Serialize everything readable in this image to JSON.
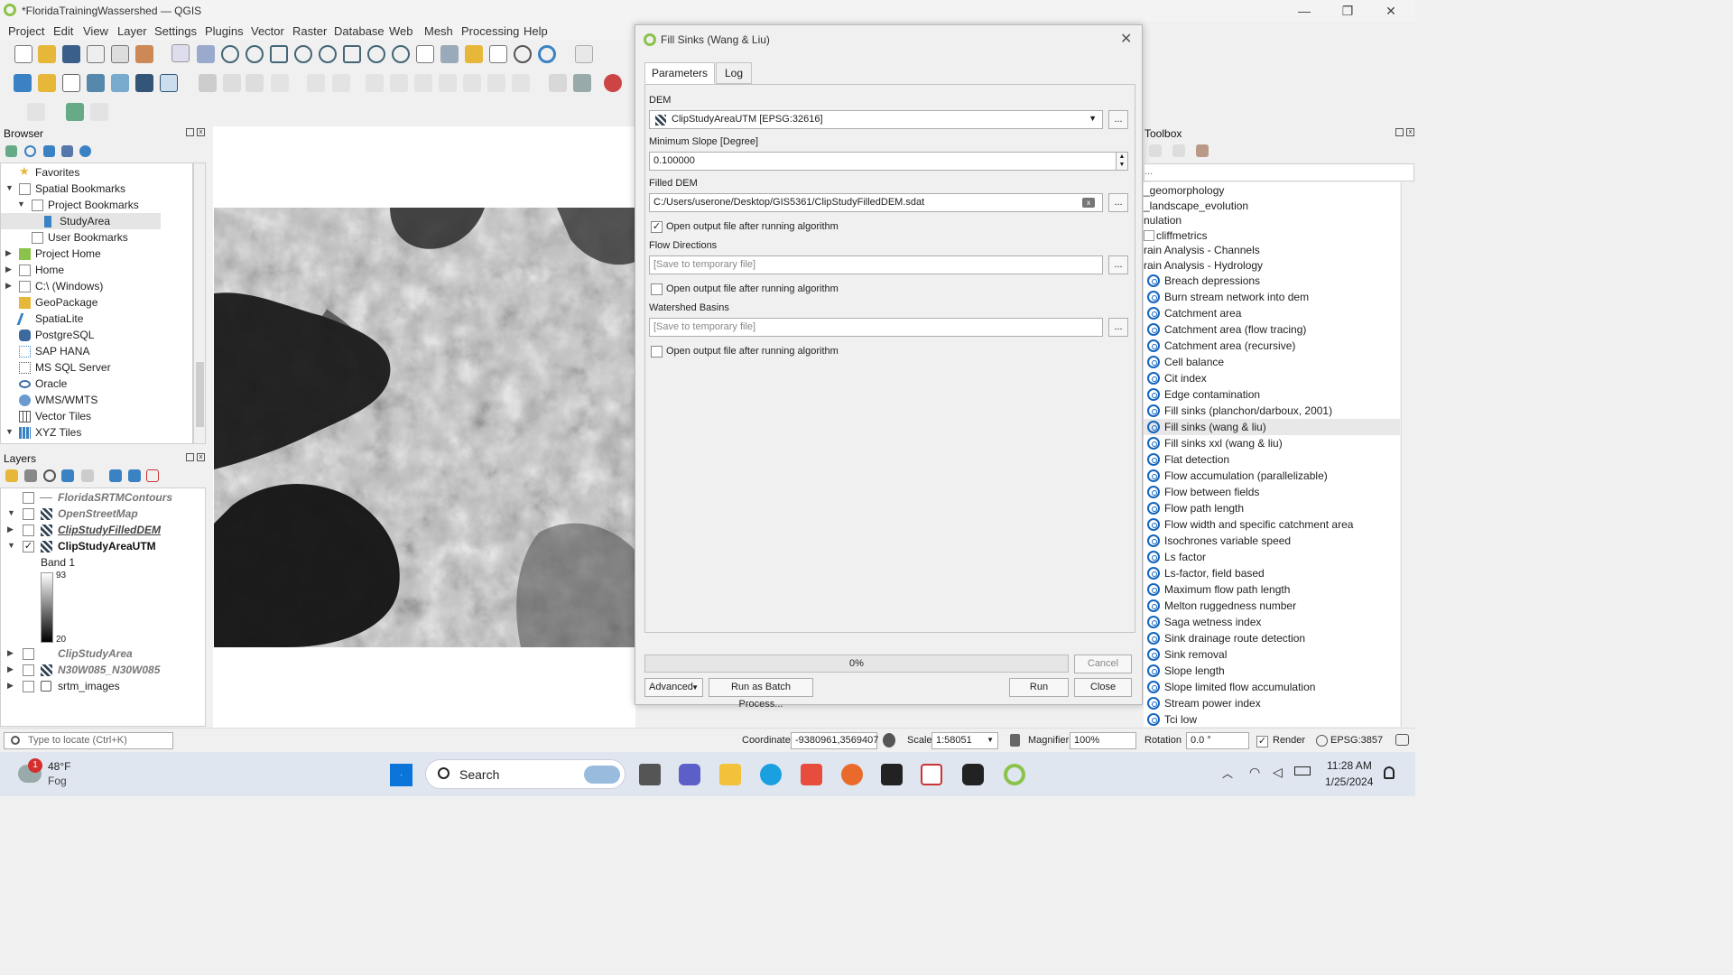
{
  "window": {
    "title": "*FloridaTrainingWassershed — QGIS"
  },
  "menu": [
    "Project",
    "Edit",
    "View",
    "Layer",
    "Settings",
    "Plugins",
    "Vector",
    "Raster",
    "Database",
    "Web",
    "Mesh",
    "Processing",
    "Help"
  ],
  "browser": {
    "title": "Browser",
    "items": [
      {
        "label": "Favorites"
      },
      {
        "label": "Spatial Bookmarks"
      },
      {
        "label": "Project Bookmarks"
      },
      {
        "label": "StudyArea"
      },
      {
        "label": "User Bookmarks"
      },
      {
        "label": "Project Home"
      },
      {
        "label": "Home"
      },
      {
        "label": "C:\\ (Windows)"
      },
      {
        "label": "GeoPackage"
      },
      {
        "label": "SpatiaLite"
      },
      {
        "label": "PostgreSQL"
      },
      {
        "label": "SAP HANA"
      },
      {
        "label": "MS SQL Server"
      },
      {
        "label": "Oracle"
      },
      {
        "label": "WMS/WMTS"
      },
      {
        "label": "Vector Tiles"
      },
      {
        "label": "XYZ Tiles"
      }
    ]
  },
  "layers": {
    "title": "Layers",
    "items": [
      {
        "label": "FloridaSRTMContours",
        "checked": false
      },
      {
        "label": "OpenStreetMap",
        "checked": false
      },
      {
        "label": "ClipStudyFilledDEM",
        "checked": false
      },
      {
        "label": "ClipStudyAreaUTM",
        "checked": true
      },
      {
        "label": "ClipStudyArea",
        "checked": false
      },
      {
        "label": "N30W085_N30W085",
        "checked": false
      },
      {
        "label": "srtm_images",
        "checked": false
      }
    ],
    "band_label": "Band 1",
    "legend_max": "93",
    "legend_min": "20"
  },
  "dialog": {
    "title": "Fill Sinks (Wang & Liu)",
    "tabs": [
      "Parameters",
      "Log"
    ],
    "dem_label": "DEM",
    "dem_value": "ClipStudyAreaUTM [EPSG:32616]",
    "min_slope_label": "Minimum Slope [Degree]",
    "min_slope_value": "0.100000",
    "filled_dem_label": "Filled DEM",
    "filled_dem_value": "C:/Users/userone/Desktop/GIS5361/ClipStudyFilledDEM.sdat",
    "open_output_label": "Open output file after running algorithm",
    "flow_dir_label": "Flow Directions",
    "watershed_label": "Watershed Basins",
    "placeholder": "[Save to temporary file]",
    "dots": "...",
    "progress": "0%",
    "progress_value": 0,
    "cancel": "Cancel",
    "advanced": "Advanced",
    "batch": "Run as Batch Process...",
    "run": "Run",
    "close": "Close"
  },
  "toolbox": {
    "title": "Toolbox",
    "groups": [
      "_geomorphology",
      "_landscape_evolution",
      "nulation",
      "cliffmetrics",
      "rain Analysis - Channels",
      "rain Analysis - Hydrology"
    ],
    "items": [
      "Breach depressions",
      "Burn stream network into dem",
      "Catchment area",
      "Catchment area (flow tracing)",
      "Catchment area (recursive)",
      "Cell balance",
      "Cit index",
      "Edge contamination",
      "Fill sinks (planchon/darboux, 2001)",
      "Fill sinks (wang & liu)",
      "Fill sinks xxl (wang & liu)",
      "Flat detection",
      "Flow accumulation (parallelizable)",
      "Flow between fields",
      "Flow path length",
      "Flow width and specific catchment area",
      "Isochrones variable speed",
      "Ls factor",
      "Ls-factor, field based",
      "Maximum flow path length",
      "Melton ruggedness number",
      "Saga wetness index",
      "Sink drainage route detection",
      "Sink removal",
      "Slope length",
      "Slope limited flow accumulation",
      "Stream power index",
      "Tci low"
    ]
  },
  "status": {
    "locate_placeholder": "Type to locate (Ctrl+K)",
    "coordinate_label": "Coordinate",
    "coordinate": "-9380961,3569407",
    "scale_label": "Scale",
    "scale": "1:58051",
    "magnifier_label": "Magnifier",
    "magnifier": "100%",
    "rotation_label": "Rotation",
    "rotation": "0.0 °",
    "render_label": "Render",
    "crs": "EPSG:3857"
  },
  "taskbar": {
    "weather_temp": "48°F",
    "weather_desc": "Fog",
    "weather_badge": "1",
    "search": "Search",
    "time": "11:28 AM",
    "date": "1/25/2024"
  },
  "colors": {
    "accent": "#1565c0",
    "qgis_green": "#8bc34a"
  }
}
